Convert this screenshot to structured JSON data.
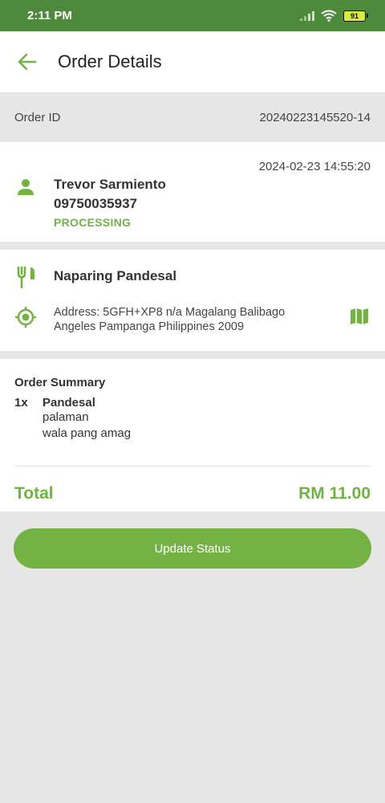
{
  "status_bar": {
    "time": "2:11 PM",
    "battery": "91"
  },
  "app_bar": {
    "title": "Order Details"
  },
  "order": {
    "id_label": "Order ID",
    "id_value": "20240223145520-14"
  },
  "customer": {
    "datetime": "2024-02-23 14:55:20",
    "name": "Trevor Sarmiento",
    "phone": "09750035937",
    "status": "PROCESSING"
  },
  "store": {
    "name": "Naparing Pandesal",
    "address_line1": "Address: 5GFH+XP8 n/a Magalang Balibago",
    "address_line2": "Angeles Pampanga Philippines 2009"
  },
  "summary": {
    "title": "Order Summary",
    "items": [
      {
        "qty": "1x",
        "name": "Pandesal",
        "notes": [
          "palaman",
          "wala pang amag"
        ]
      }
    ],
    "total_label": "Total",
    "total_value": "RM 11.00"
  },
  "actions": {
    "update_status": "Update Status"
  },
  "colors": {
    "accent": "#74b243",
    "status_bar": "#4d8a3b",
    "background": "#e6e6e6"
  },
  "icons": [
    "back-arrow-icon",
    "person-icon",
    "fork-knife-icon",
    "location-target-icon",
    "map-icon",
    "signal-icon",
    "wifi-icon",
    "battery-icon"
  ]
}
